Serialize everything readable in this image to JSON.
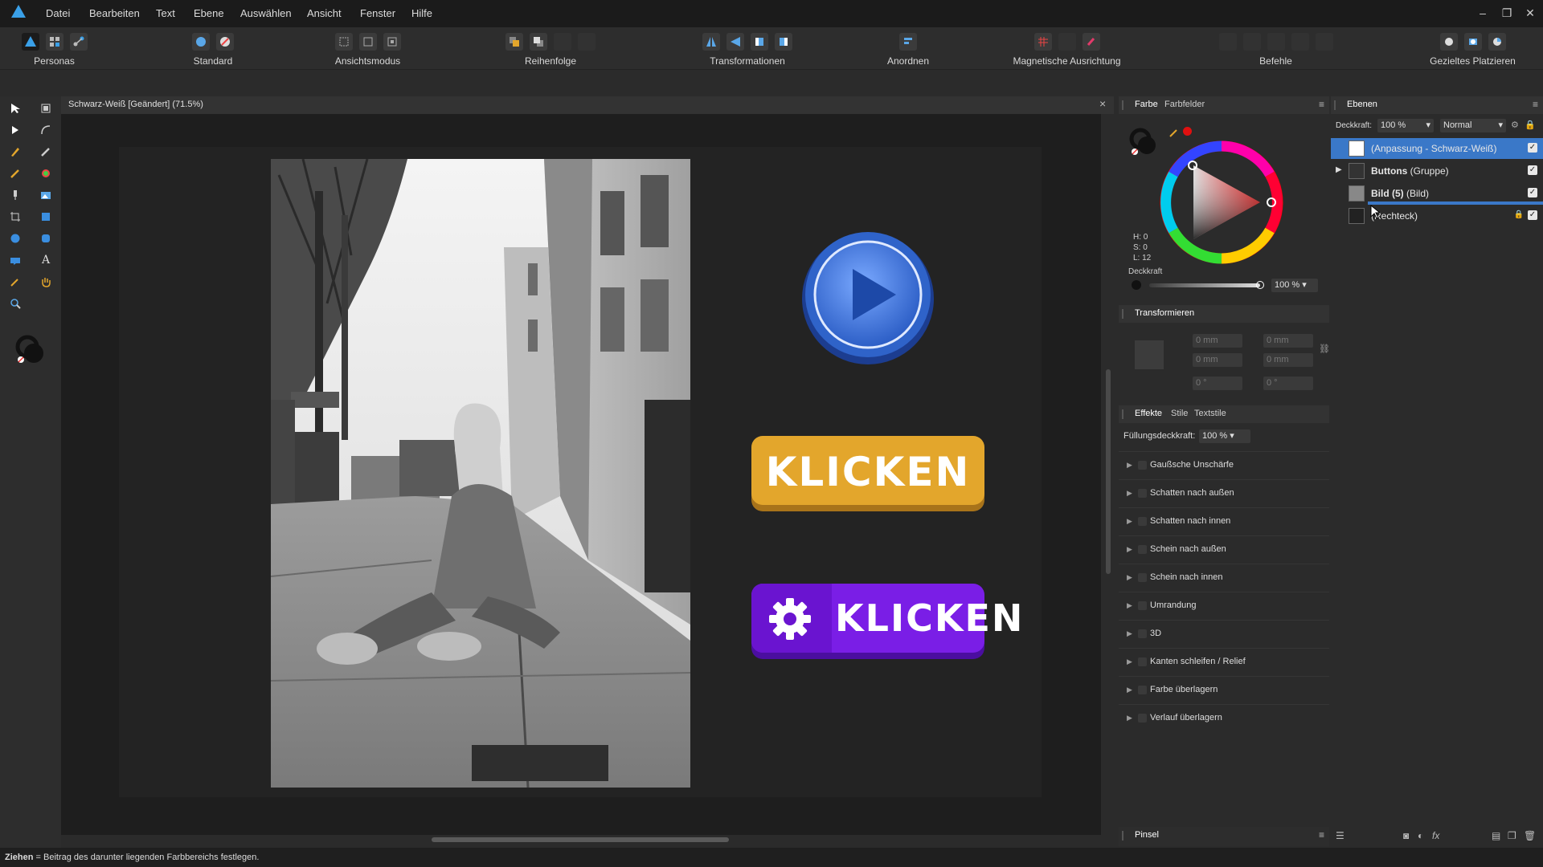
{
  "menu": {
    "items": [
      "Datei",
      "Bearbeiten",
      "Text",
      "Ebene",
      "Auswählen",
      "Ansicht",
      "Fenster",
      "Hilfe"
    ],
    "window_controls": [
      "–",
      "❐",
      "✕"
    ]
  },
  "toolbar": {
    "groups": [
      {
        "label": "Personas",
        "icons": [
          "designer-persona-icon",
          "pixel-persona-icon",
          "export-persona-icon"
        ]
      },
      {
        "label": "Standard",
        "icons": [
          "assets-icon",
          "brush-settings-icon"
        ]
      },
      {
        "label": "Ansichtsmodus",
        "icons": [
          "view-mode-1-icon",
          "view-mode-2-icon",
          "view-mode-3-icon"
        ]
      },
      {
        "label": "Reihenfolge",
        "icons": [
          "bring-forward-icon",
          "send-back-icon",
          "order-3-icon",
          "order-4-icon"
        ]
      },
      {
        "label": "Transformationen",
        "icons": [
          "flip-horizontal-icon",
          "flip-vertical-icon",
          "rotate-left-icon",
          "rotate-right-icon"
        ]
      },
      {
        "label": "Anordnen",
        "icons": [
          "align-icon"
        ]
      },
      {
        "label": "Magnetische Ausrichtung",
        "icons": [
          "grid-snap-icon",
          "snap-2-icon",
          "magnet-icon"
        ]
      },
      {
        "label": "Befehle",
        "icons": [
          "cmd-1-icon",
          "cmd-2-icon",
          "cmd-3-icon",
          "cmd-4-icon",
          "cmd-5-icon"
        ]
      },
      {
        "label": "Gezieltes Platzieren",
        "icons": [
          "place-1-icon",
          "place-2-icon",
          "place-3-icon"
        ]
      }
    ]
  },
  "document": {
    "title": "Schwarz-Weiß [Geändert] (71.5%)",
    "close_glyph": "×",
    "orange_button_text": "KLICKEN",
    "purple_button_text": "KLICKEN"
  },
  "color_panel": {
    "tabs": [
      "Farbe",
      "Farbfelder"
    ],
    "hsl": {
      "h": "H: 0",
      "s": "S: 0",
      "l": "L: 12"
    },
    "opacity_label": "Deckkraft",
    "opacity_value": "100 %"
  },
  "transform_panel": {
    "title": "Transformieren",
    "fields": [
      "0 mm",
      "0 mm",
      "0 mm",
      "0 mm",
      "0 °",
      "0 °"
    ]
  },
  "effects_panel": {
    "tabs": [
      "Effekte",
      "Stile",
      "Textstile"
    ],
    "fill_opacity_label": "Füllungsdeckkraft:",
    "fill_opacity_value": "100 %",
    "effects": [
      "Gaußsche Unschärfe",
      "Schatten nach außen",
      "Schatten nach innen",
      "Schein nach außen",
      "Schein nach innen",
      "Umrandung",
      "3D",
      "Kanten schleifen / Relief",
      "Farbe überlagern",
      "Verlauf überlagern"
    ]
  },
  "brush_panel": {
    "title": "Pinsel"
  },
  "layers_panel": {
    "title": "Ebenen",
    "opacity_label": "Deckkraft:",
    "opacity_value": "100 %",
    "blend_mode": "Normal",
    "layers": [
      {
        "name_bold": "",
        "name": "(Anpassung - Schwarz-Weiß)",
        "selected": true,
        "locked": false
      },
      {
        "name_bold": "Buttons",
        "name": " (Gruppe)",
        "selected": false,
        "locked": false
      },
      {
        "name_bold": "Bild (5)",
        "name": " (Bild)",
        "selected": false,
        "locked": false
      },
      {
        "name_bold": "",
        "name": "(Rechteck)",
        "selected": false,
        "locked": true
      }
    ]
  },
  "status": {
    "bold": "Ziehen",
    "text": " = Beitrag des darunter liegenden Farbbereichs festlegen."
  },
  "colors": {
    "accent": "#3a78c8",
    "orange_button": "#e3a62c",
    "purple_button": "#7a1ee6",
    "play_button": "#2f63c9"
  }
}
